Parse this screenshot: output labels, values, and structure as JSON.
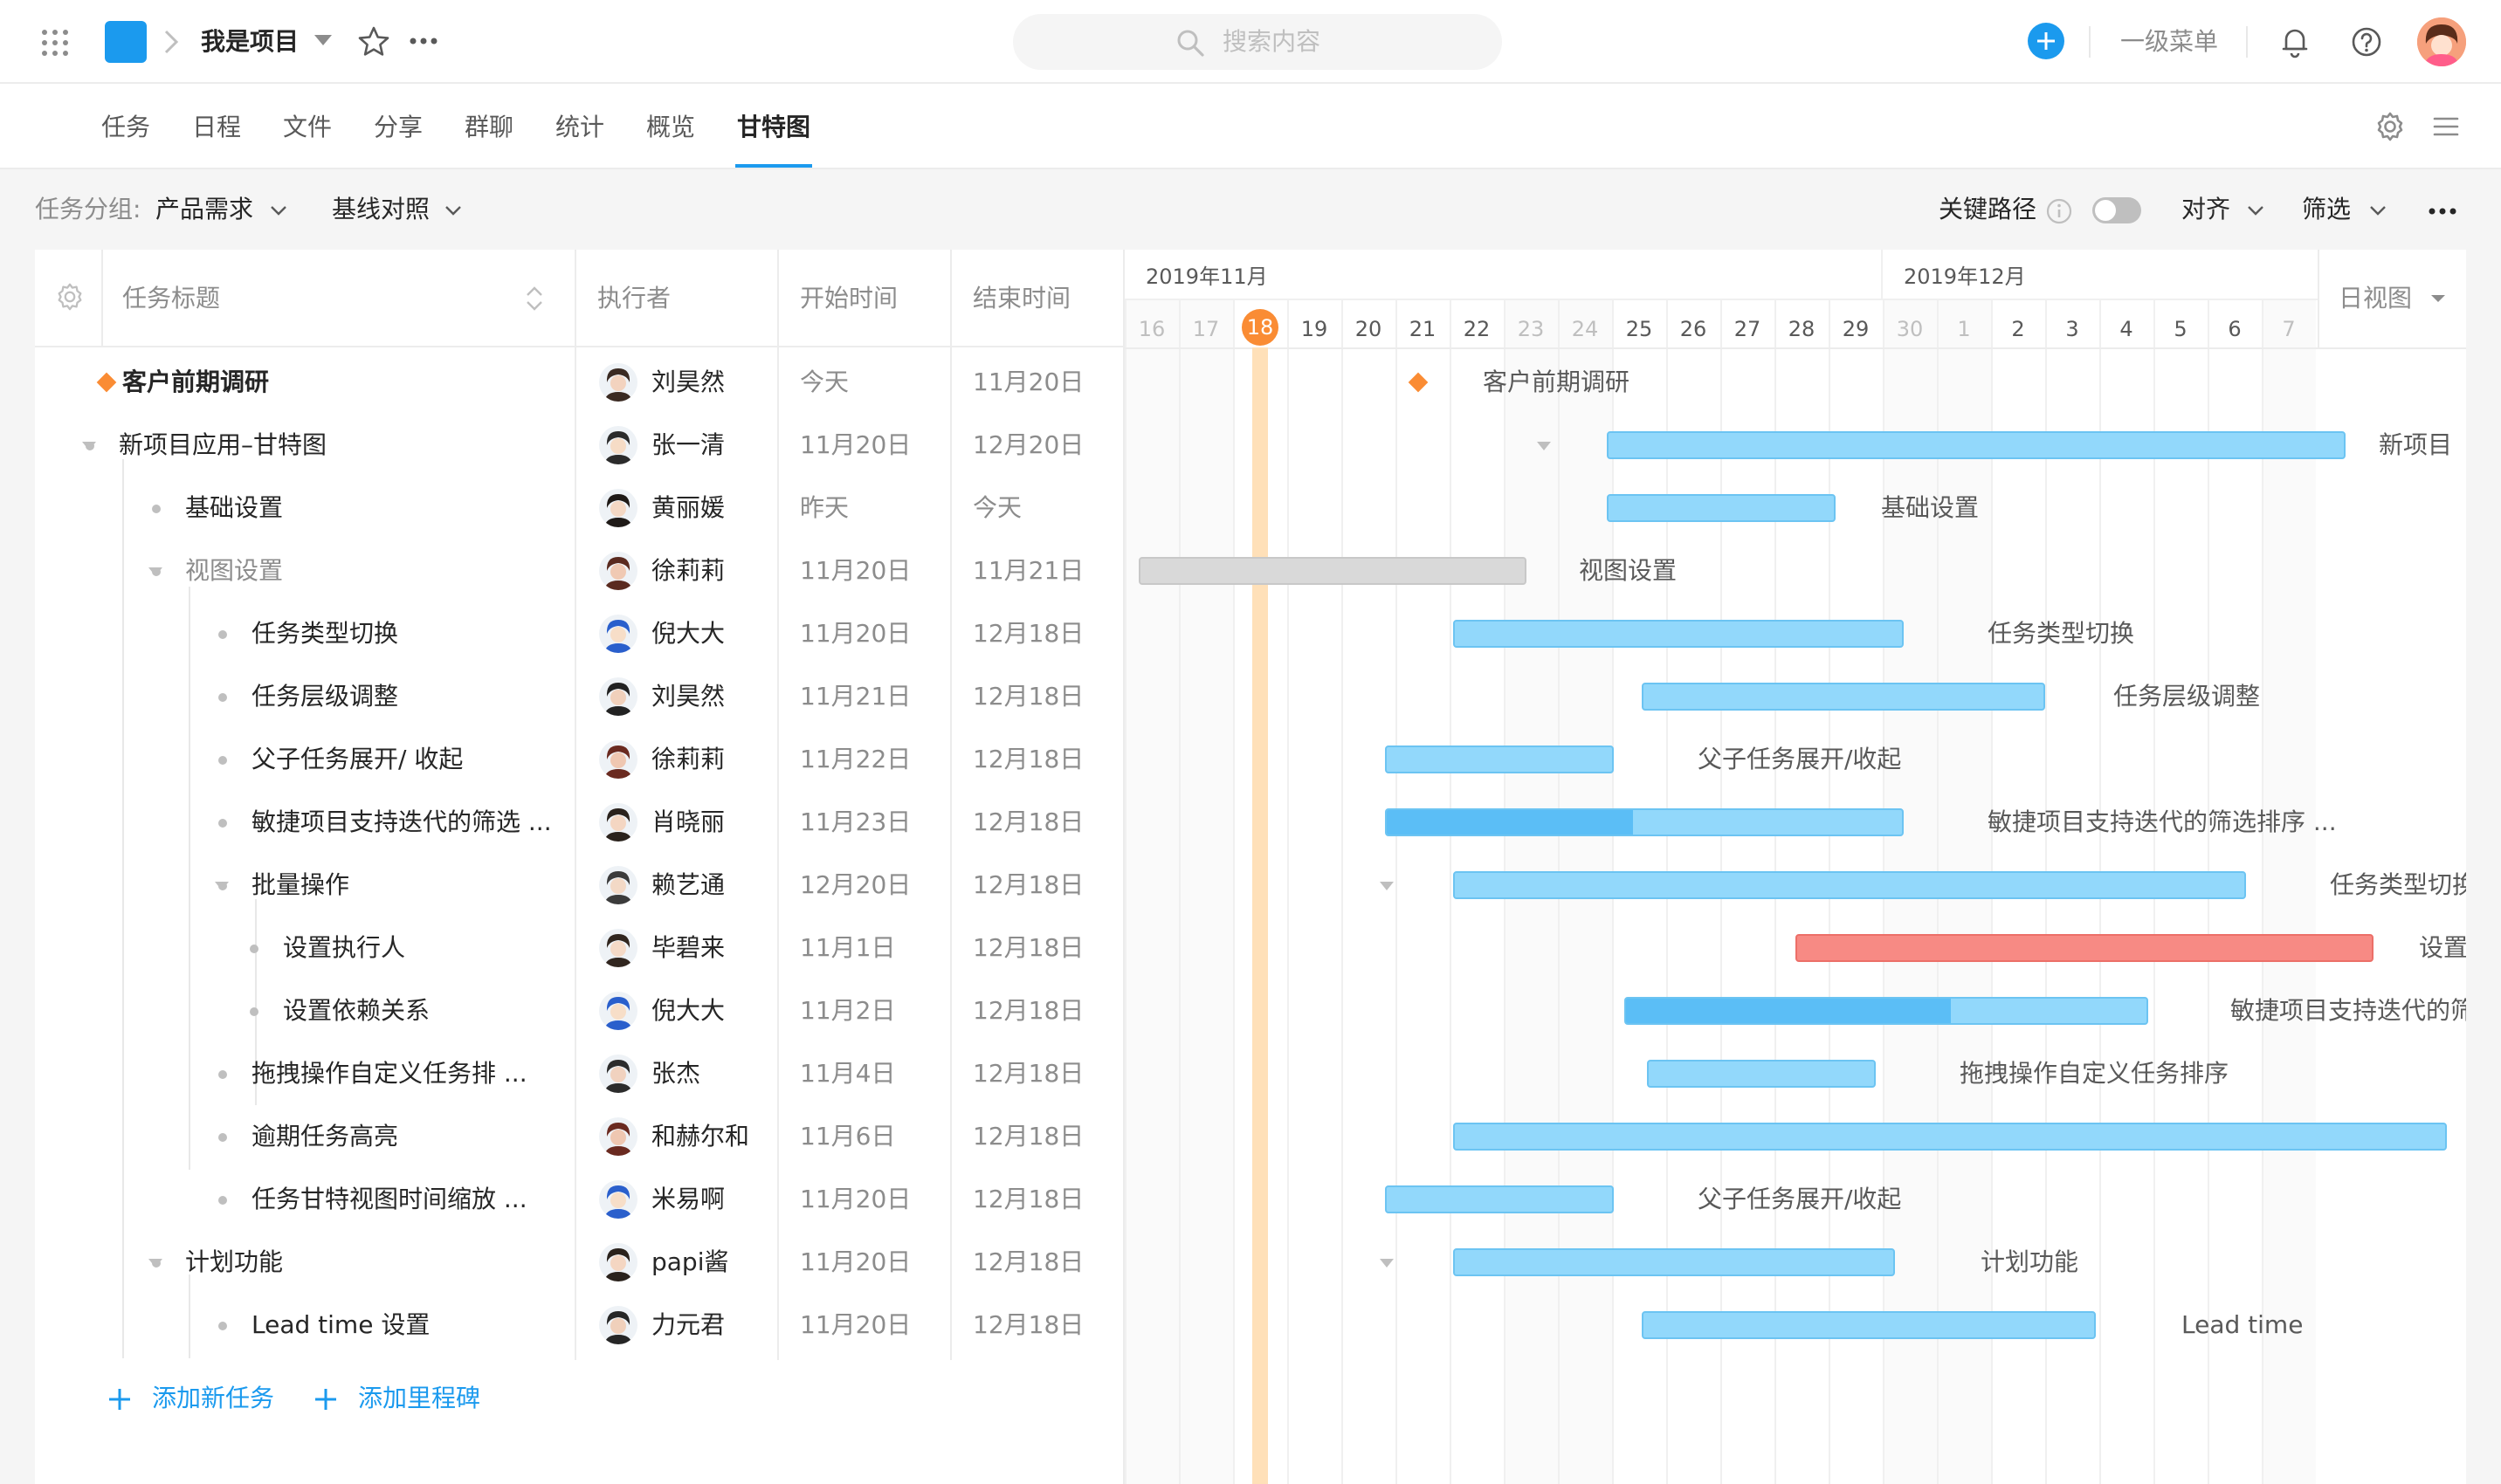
{
  "header": {
    "project_name": "我是项目",
    "search_placeholder": "搜索内容",
    "menu_label": "一级菜单",
    "accent": "#1b9aee"
  },
  "tabs": [
    "任务",
    "日程",
    "文件",
    "分享",
    "群聊",
    "统计",
    "概览",
    "甘特图"
  ],
  "active_tab": "甘特图",
  "filter": {
    "group_label": "任务分组:",
    "group_value": "产品需求",
    "baseline": "基线对照",
    "critical_path": "关键路径",
    "align": "对齐",
    "filter": "筛选"
  },
  "columns": {
    "title": "任务标题",
    "assignee": "执行者",
    "start": "开始时间",
    "end": "结束时间"
  },
  "gantt": {
    "months": [
      "2019年11月",
      "2019年12月"
    ],
    "days": [
      "16",
      "17",
      "18",
      "19",
      "20",
      "21",
      "22",
      "23",
      "24",
      "25",
      "26",
      "27",
      "28",
      "29",
      "30",
      "1",
      "2",
      "3",
      "4",
      "5",
      "6",
      "7"
    ],
    "today": "18",
    "view": "日视图"
  },
  "tasks": [
    {
      "title": "客户前期调研",
      "assignee": "刘昊然",
      "start": "今天",
      "end": "11月20日",
      "bar_label": "客户前期调研"
    },
    {
      "title": "新项目应用–甘特图",
      "assignee": "张一清",
      "start": "11月20日",
      "end": "12月20日",
      "bar_label": "新项目"
    },
    {
      "title": "基础设置",
      "assignee": "黄丽媛",
      "start": "昨天",
      "end": "今天",
      "bar_label": "基础设置"
    },
    {
      "title": "视图设置",
      "assignee": "徐莉莉",
      "start": "11月20日",
      "end": "11月21日",
      "bar_label": "视图设置"
    },
    {
      "title": "任务类型切换",
      "assignee": "倪大大",
      "start": "11月20日",
      "end": "12月18日",
      "bar_label": "任务类型切换"
    },
    {
      "title": "任务层级调整",
      "assignee": "刘昊然",
      "start": "11月21日",
      "end": "12月18日",
      "bar_label": "任务层级调整"
    },
    {
      "title": "父子任务展开/ 收起",
      "assignee": "徐莉莉",
      "start": "11月22日",
      "end": "12月18日",
      "bar_label": "父子任务展开/收起"
    },
    {
      "title": "敏捷项目支持迭代的筛选 ...",
      "assignee": "肖晓丽",
      "start": "11月23日",
      "end": "12月18日",
      "bar_label": "敏捷项目支持迭代的筛选排序 ..."
    },
    {
      "title": "批量操作",
      "assignee": "赖艺通",
      "start": "12月20日",
      "end": "12月18日",
      "bar_label": "任务类型切换"
    },
    {
      "title": "设置执行人",
      "assignee": "毕碧来",
      "start": "11月1日",
      "end": "12月18日",
      "bar_label": "设置执行"
    },
    {
      "title": "设置依赖关系",
      "assignee": "倪大大",
      "start": "11月2日",
      "end": "12月18日",
      "bar_label": "敏捷项目支持迭代的筛选"
    },
    {
      "title": "拖拽操作自定义任务排 ...",
      "assignee": "张杰",
      "start": "11月4日",
      "end": "12月18日",
      "bar_label": "拖拽操作自定义任务排序"
    },
    {
      "title": "逾期任务高亮",
      "assignee": "和赫尔和",
      "start": "11月6日",
      "end": "12月18日",
      "bar_label": ""
    },
    {
      "title": "任务甘特视图时间缩放 ...",
      "assignee": "米易啊",
      "start": "11月20日",
      "end": "12月18日",
      "bar_label": "父子任务展开/收起"
    },
    {
      "title": "计划功能",
      "assignee": "papi酱",
      "start": "11月20日",
      "end": "12月18日",
      "bar_label": "计划功能"
    },
    {
      "title": "Lead time 设置",
      "assignee": "力元君",
      "start": "11月20日",
      "end": "12月18日",
      "bar_label": "Lead time"
    }
  ],
  "add_task": "添加新任务",
  "add_milestone": "添加里程碑"
}
